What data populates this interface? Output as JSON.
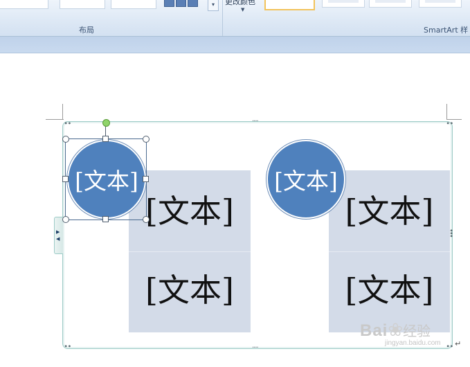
{
  "ribbon": {
    "layout_group_label": "布局",
    "smartart_styles_group_label": "SmartArt 样",
    "change_colors_label": "更改颜色",
    "accent_color": "#4f81bd",
    "selected_style_border": "#f2c35a"
  },
  "diagram": {
    "left_circle_text": "[文本]",
    "right_circle_text": "[文本]",
    "left_top_text": "[文本]",
    "left_bottom_text": "[文本]",
    "right_top_text": "[文本]",
    "right_bottom_text": "[文本]",
    "circle_color": "#4f81bd",
    "rect_color": "#d3dbe8"
  },
  "watermark": {
    "brand": "Bai",
    "brand_tail": "经验",
    "url": "jingyan.baidu.com"
  }
}
